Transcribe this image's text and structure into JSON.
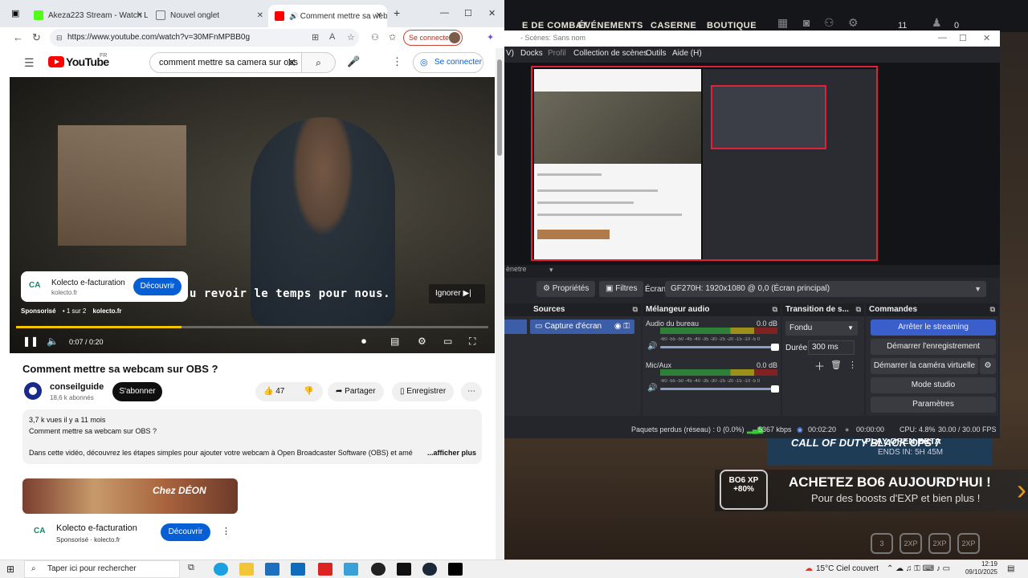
{
  "game": {
    "menu": [
      "E DE COMBAT",
      "ÉVÉNEMENTS",
      "CASERNE",
      "BOUTIQUE"
    ],
    "counter_a": "11",
    "counter_b": "0",
    "promo_title": "CALL OF DUTY BLACK OPS 7",
    "promo_play": "PLAY OPEN BETA",
    "promo_ends": "ENDS IN: 5H 45M",
    "xp_badge": "BO6 XP +80%",
    "promo_headline": "ACHETEZ BO6 AUJOURD'HUI !",
    "promo_sub": "Pour des boosts d'EXP et bien plus !",
    "badges": [
      "3",
      "2XP",
      "2XP",
      "2XP"
    ]
  },
  "obs": {
    "title": "- Scènes: Sans nom",
    "menu": [
      "V)",
      "Docks",
      "Profil",
      "Collection de scènes",
      "Outils",
      "Aide (H)"
    ],
    "strip_label": "ènetre",
    "toolbar": {
      "properties": "Propriétés",
      "filters": "Filtres",
      "screen_label": "Écran",
      "screen_value": "GF270H: 1920x1080 @ 0,0 (Écran principal)"
    },
    "docks": {
      "sources_title": "Sources",
      "source_item": "Capture d'écran",
      "mixer_title": "Mélangeur audio",
      "channels": [
        {
          "name": "Audio du bureau",
          "db": "0.0 dB"
        },
        {
          "name": "Mic/Aux",
          "db": "0.0 dB"
        }
      ],
      "ticks": "-60 -55 -50 -45 -40 -35 -30 -25 -20 -15 -10 -5 0",
      "transition_title": "Transition de s...",
      "transition_value": "Fondu",
      "duration_label": "Durée",
      "duration_value": "300 ms",
      "commands_title": "Commandes",
      "commands": [
        "Arrêter le streaming",
        "Démarrer l'enregistrement",
        "Démarrer la caméra virtuelle",
        "Mode studio",
        "Paramètres"
      ]
    },
    "status": {
      "dropped": "Paquets perdus (réseau) : 0 (0.0%)",
      "bitrate": "5367 kbps",
      "live_time": "00:02:20",
      "rec_time": "00:00:00",
      "cpu": "CPU: 4.8%",
      "fps": "30.00 / 30.00 FPS"
    }
  },
  "browser": {
    "tabs": [
      {
        "label": "Akeza223 Stream - Watch Live",
        "color": "#53fc18"
      },
      {
        "label": "Nouvel onglet",
        "color": "#ffffff"
      },
      {
        "label": "Comment mettre sa web",
        "color": "#ff0000"
      }
    ],
    "url": "https://www.youtube.com/watch?v=30MFnMPBB0g",
    "connect": "Se connecter"
  },
  "youtube": {
    "logo": "YouTube",
    "region": "FR",
    "search_value": "comment mettre sa camera sur obs",
    "signin": "Se connecter",
    "ad_card": {
      "name": "Kolecto e-facturation",
      "domain": "kolecto.fr",
      "cta": "Découvrir"
    },
    "subtitle": "u revoir le temps pour nous.",
    "skip": "Ignorer",
    "ad_info": {
      "sponsored": "Sponsorisé",
      "count": "• 1 sur 2",
      "domain": "kolecto.fr"
    },
    "time": "0:07 / 0:20",
    "progress": 0.35,
    "video_title": "Comment mettre sa webcam sur OBS ?",
    "channel": "conseilguide",
    "subscribers": "18,6 k abonnés",
    "subscribe": "S'abonner",
    "likes": "47",
    "share": "Partager",
    "save": "Enregistrer",
    "desc": {
      "meta": "3,7 k vues  il y a 11 mois",
      "title": "Comment mettre sa webcam sur OBS ?",
      "body": "Dans cette vidéo, découvrez les étapes simples pour ajouter votre webcam à Open Broadcaster Software (OBS) et amé",
      "more": "...afficher plus"
    },
    "ad2": {
      "banner": "Chez DÉON",
      "name": "Kolecto e-facturation",
      "sponsored": "Sponsorisé · kolecto.fr",
      "cta": "Découvrir"
    }
  },
  "taskbar": {
    "search": "Taper ici pour rechercher",
    "weather": "15°C  Ciel couvert",
    "time": "12:19",
    "date": "09/10/2025"
  }
}
